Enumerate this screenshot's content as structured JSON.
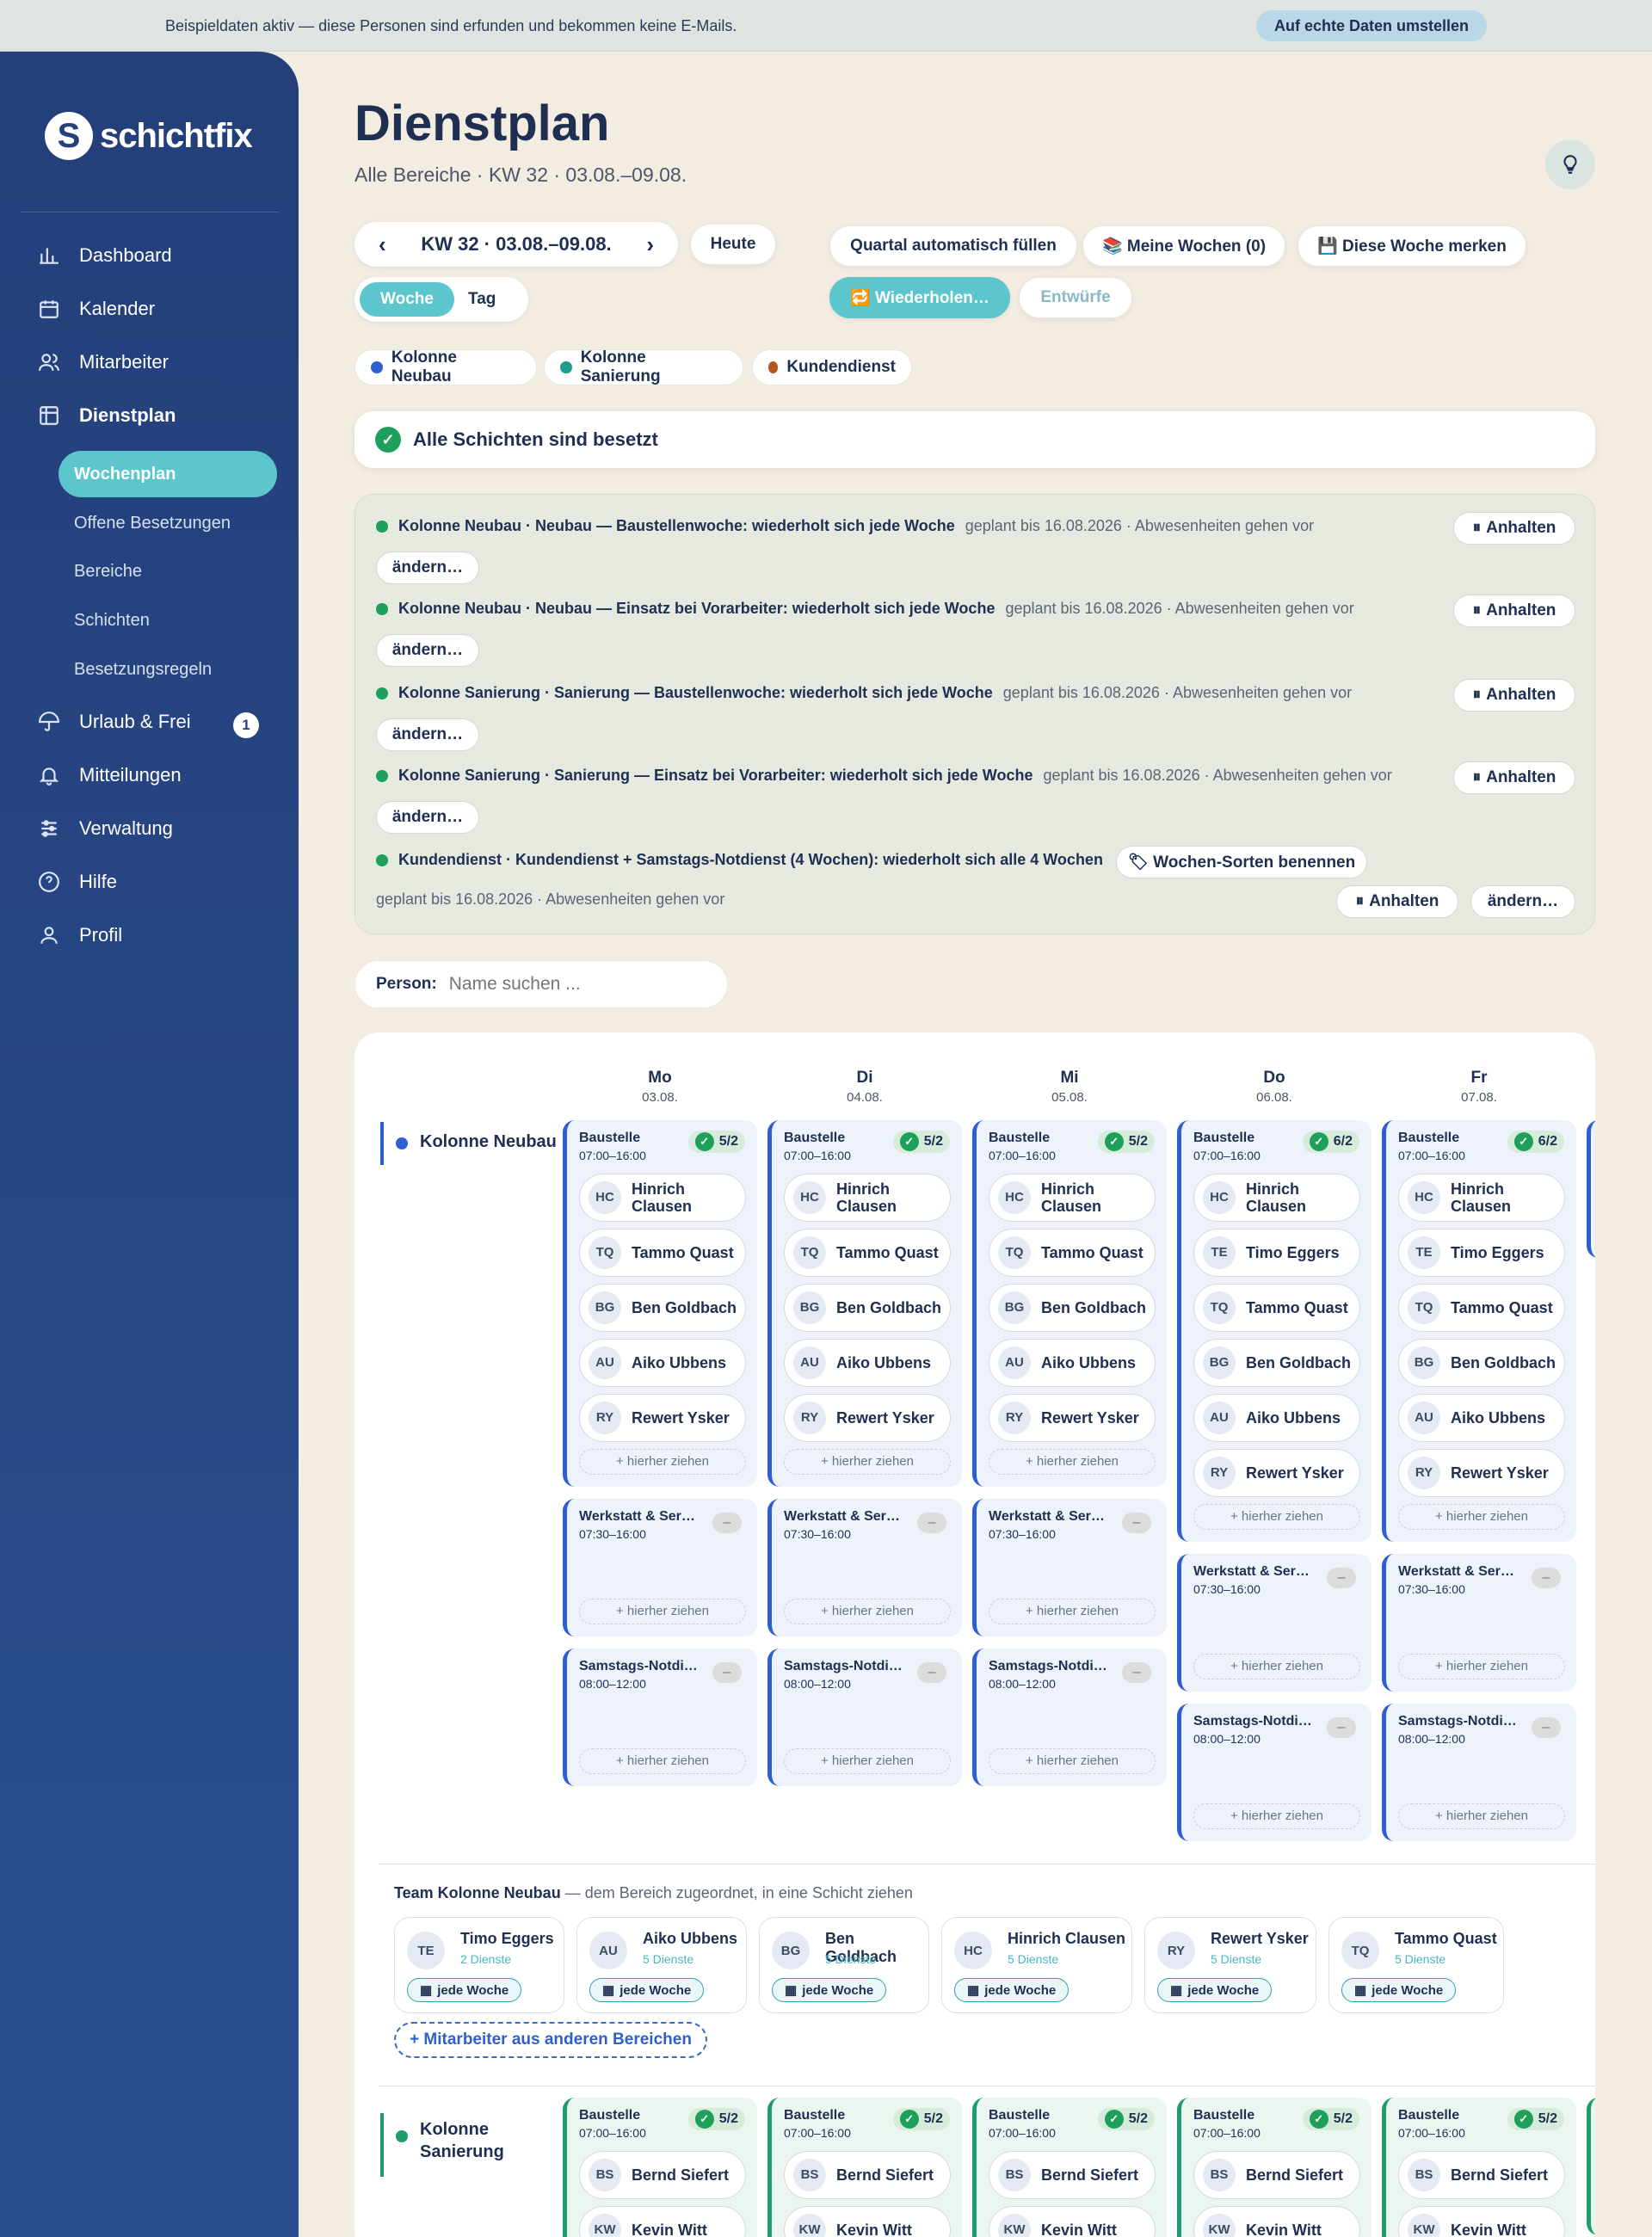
{
  "banner": {
    "text": "Beispieldaten aktiv — diese Personen sind erfunden und bekommen keine E-Mails.",
    "button": "Auf echte Daten umstellen"
  },
  "app": {
    "logo_letter": "S",
    "name": "schichtfix"
  },
  "nav": [
    {
      "label": "Dashboard",
      "icon": "chart-icon"
    },
    {
      "label": "Kalender",
      "icon": "calendar-icon"
    },
    {
      "label": "Mitarbeiter",
      "icon": "users-icon"
    },
    {
      "label": "Dienstplan",
      "icon": "grid-icon"
    },
    {
      "label": "Urlaub & Frei",
      "icon": "umbrella-icon",
      "badge": "1"
    },
    {
      "label": "Mitteilungen",
      "icon": "bell-icon"
    },
    {
      "label": "Verwaltung",
      "icon": "sliders-icon"
    },
    {
      "label": "Hilfe",
      "icon": "help-icon"
    },
    {
      "label": "Profil",
      "icon": "user-icon"
    }
  ],
  "subnav": [
    "Wochenplan",
    "Offene Besetzungen",
    "Bereiche",
    "Schichten",
    "Besetzungsregeln"
  ],
  "page": {
    "title": "Dienstplan",
    "subtitle": "Alle Bereiche · KW 32 · 03.08.–09.08."
  },
  "toolbar": {
    "week": "KW 32 · 03.08.–09.08.",
    "today": "Heute",
    "view_week": "Woche",
    "view_day": "Tag",
    "fill_quarter": "Quartal automatisch füllen",
    "my_weeks": "📚 Meine Wochen (0)",
    "remember_week": "💾 Diese Woche merken",
    "repeat": "🔁 Wiederholen…",
    "drafts": "Entwürfe"
  },
  "legend": [
    {
      "label": "Kolonne Neubau",
      "color": "#2e5fd1"
    },
    {
      "label": "Kolonne Sanierung",
      "color": "#1e9c8c"
    },
    {
      "label": "Kundendienst",
      "color": "#b5561c"
    }
  ],
  "status": {
    "text": "Alle Schichten sind besetzt"
  },
  "rules": [
    {
      "title": "Kolonne Neubau · Neubau — Baustellenwoche: wiederholt sich jede Woche",
      "info": "geplant bis 16.08.2026 · Abwesenheiten gehen vor",
      "pause": "Anhalten",
      "change": "ändern…"
    },
    {
      "title": "Kolonne Neubau · Neubau — Einsatz bei Vorarbeiter: wiederholt sich jede Woche",
      "info": "geplant bis 16.08.2026 · Abwesenheiten gehen vor",
      "pause": "Anhalten",
      "change": "ändern…"
    },
    {
      "title": "Kolonne Sanierung · Sanierung — Baustellenwoche: wiederholt sich jede Woche",
      "info": "geplant bis 16.08.2026 · Abwesenheiten gehen vor",
      "pause": "Anhalten",
      "change": "ändern…"
    },
    {
      "title": "Kolonne Sanierung · Sanierung — Einsatz bei Vorarbeiter: wiederholt sich jede Woche",
      "info": "geplant bis 16.08.2026 · Abwesenheiten gehen vor",
      "pause": "Anhalten",
      "change": "ändern…"
    },
    {
      "title": "Kundendienst · Kundendienst + Samstags-Notdienst (4 Wochen): wiederholt sich alle 4 Wochen",
      "info": "geplant bis 16.08.2026 · Abwesenheiten gehen vor",
      "pause": "Anhalten",
      "change": "ändern…",
      "extra": "🏷 Wochen-Sorten benennen"
    }
  ],
  "search": {
    "label": "Person:",
    "placeholder": "Name suchen ..."
  },
  "days": [
    {
      "name": "Mo",
      "date": "03.08."
    },
    {
      "name": "Di",
      "date": "04.08."
    },
    {
      "name": "Mi",
      "date": "05.08."
    },
    {
      "name": "Do",
      "date": "06.08."
    },
    {
      "name": "Fr",
      "date": "07.08."
    }
  ],
  "drop_label": "+ hierher ziehen",
  "areas": [
    {
      "name": "Kolonne Neubau",
      "color": "#2e5fd1",
      "columns": [
        {
          "shifts": [
            {
              "title": "Baustelle",
              "time": "07:00–16:00",
              "count": "5/2",
              "staff": [
                [
                  "HC",
                  "Hinrich Clausen"
                ],
                [
                  "TQ",
                  "Tammo Quast"
                ],
                [
                  "BG",
                  "Ben Goldbach"
                ],
                [
                  "AU",
                  "Aiko Ubbens"
                ],
                [
                  "RY",
                  "Rewert Ysker"
                ]
              ]
            },
            {
              "title": "Werkstatt & Ser…",
              "time": "07:30–16:00",
              "count": "",
              "staff": []
            },
            {
              "title": "Samstags-Notdi…",
              "time": "08:00–12:00",
              "count": "",
              "staff": []
            }
          ]
        },
        {
          "shifts": [
            {
              "title": "Baustelle",
              "time": "07:00–16:00",
              "count": "5/2",
              "staff": [
                [
                  "HC",
                  "Hinrich Clausen"
                ],
                [
                  "TQ",
                  "Tammo Quast"
                ],
                [
                  "BG",
                  "Ben Goldbach"
                ],
                [
                  "AU",
                  "Aiko Ubbens"
                ],
                [
                  "RY",
                  "Rewert Ysker"
                ]
              ]
            },
            {
              "title": "Werkstatt & Ser…",
              "time": "07:30–16:00",
              "count": "",
              "staff": []
            },
            {
              "title": "Samstags-Notdi…",
              "time": "08:00–12:00",
              "count": "",
              "staff": []
            }
          ]
        },
        {
          "shifts": [
            {
              "title": "Baustelle",
              "time": "07:00–16:00",
              "count": "5/2",
              "staff": [
                [
                  "HC",
                  "Hinrich Clausen"
                ],
                [
                  "TQ",
                  "Tammo Quast"
                ],
                [
                  "BG",
                  "Ben Goldbach"
                ],
                [
                  "AU",
                  "Aiko Ubbens"
                ],
                [
                  "RY",
                  "Rewert Ysker"
                ]
              ]
            },
            {
              "title": "Werkstatt & Ser…",
              "time": "07:30–16:00",
              "count": "",
              "staff": []
            },
            {
              "title": "Samstags-Notdi…",
              "time": "08:00–12:00",
              "count": "",
              "staff": []
            }
          ]
        },
        {
          "shifts": [
            {
              "title": "Baustelle",
              "time": "07:00–16:00",
              "count": "6/2",
              "staff": [
                [
                  "HC",
                  "Hinrich Clausen"
                ],
                [
                  "TE",
                  "Timo Eggers"
                ],
                [
                  "TQ",
                  "Tammo Quast"
                ],
                [
                  "BG",
                  "Ben Goldbach"
                ],
                [
                  "AU",
                  "Aiko Ubbens"
                ],
                [
                  "RY",
                  "Rewert Ysker"
                ]
              ]
            },
            {
              "title": "Werkstatt & Ser…",
              "time": "07:30–16:00",
              "count": "",
              "staff": []
            },
            {
              "title": "Samstags-Notdi…",
              "time": "08:00–12:00",
              "count": "",
              "staff": []
            }
          ]
        },
        {
          "shifts": [
            {
              "title": "Baustelle",
              "time": "07:00–16:00",
              "count": "6/2",
              "staff": [
                [
                  "HC",
                  "Hinrich Clausen"
                ],
                [
                  "TE",
                  "Timo Eggers"
                ],
                [
                  "TQ",
                  "Tammo Quast"
                ],
                [
                  "BG",
                  "Ben Goldbach"
                ],
                [
                  "AU",
                  "Aiko Ubbens"
                ],
                [
                  "RY",
                  "Rewert Ysker"
                ]
              ]
            },
            {
              "title": "Werkstatt & Ser…",
              "time": "07:30–16:00",
              "count": "",
              "staff": []
            },
            {
              "title": "Samstags-Notdi…",
              "time": "08:00–12:00",
              "count": "",
              "staff": []
            }
          ]
        }
      ]
    },
    {
      "name": "Kolonne Sanierung",
      "color": "#1e9c6c",
      "columns": [
        {
          "shifts": [
            {
              "title": "Baustelle",
              "time": "07:00–16:00",
              "count": "5/2",
              "staff": [
                [
                  "BS",
                  "Bernd Siefert"
                ],
                [
                  "KW",
                  "Kevin Witt"
                ]
              ]
            }
          ]
        },
        {
          "shifts": [
            {
              "title": "Baustelle",
              "time": "07:00–16:00",
              "count": "5/2",
              "staff": [
                [
                  "BS",
                  "Bernd Siefert"
                ],
                [
                  "KW",
                  "Kevin Witt"
                ]
              ]
            }
          ]
        },
        {
          "shifts": [
            {
              "title": "Baustelle",
              "time": "07:00–16:00",
              "count": "5/2",
              "staff": [
                [
                  "BS",
                  "Bernd Siefert"
                ],
                [
                  "KW",
                  "Kevin Witt"
                ]
              ]
            }
          ]
        },
        {
          "shifts": [
            {
              "title": "Baustelle",
              "time": "07:00–16:00",
              "count": "5/2",
              "staff": [
                [
                  "BS",
                  "Bernd Siefert"
                ],
                [
                  "KW",
                  "Kevin Witt"
                ]
              ]
            }
          ]
        },
        {
          "shifts": [
            {
              "title": "Baustelle",
              "time": "07:00–16:00",
              "count": "5/2",
              "staff": [
                [
                  "BS",
                  "Bernd Siefert"
                ],
                [
                  "KW",
                  "Kevin Witt"
                ]
              ]
            }
          ]
        }
      ]
    }
  ],
  "team": {
    "title": "Team Kolonne Neubau",
    "hint": " — dem Bereich zugeordnet, in eine Schicht ziehen",
    "tag": "jede Woche",
    "members": [
      {
        "initials": "TE",
        "name": "Timo Eggers",
        "detail": "2 Dienste"
      },
      {
        "initials": "AU",
        "name": "Aiko Ubbens",
        "detail": "5 Dienste"
      },
      {
        "initials": "BG",
        "name": "Ben Goldbach",
        "detail": "5 Dienste"
      },
      {
        "initials": "HC",
        "name": "Hinrich Clausen",
        "detail": "5 Dienste"
      },
      {
        "initials": "RY",
        "name": "Rewert Ysker",
        "detail": "5 Dienste"
      },
      {
        "initials": "TQ",
        "name": "Tammo Quast",
        "detail": "5 Dienste"
      }
    ],
    "add_button": "+ Mitarbeiter aus anderen Bereichen"
  }
}
